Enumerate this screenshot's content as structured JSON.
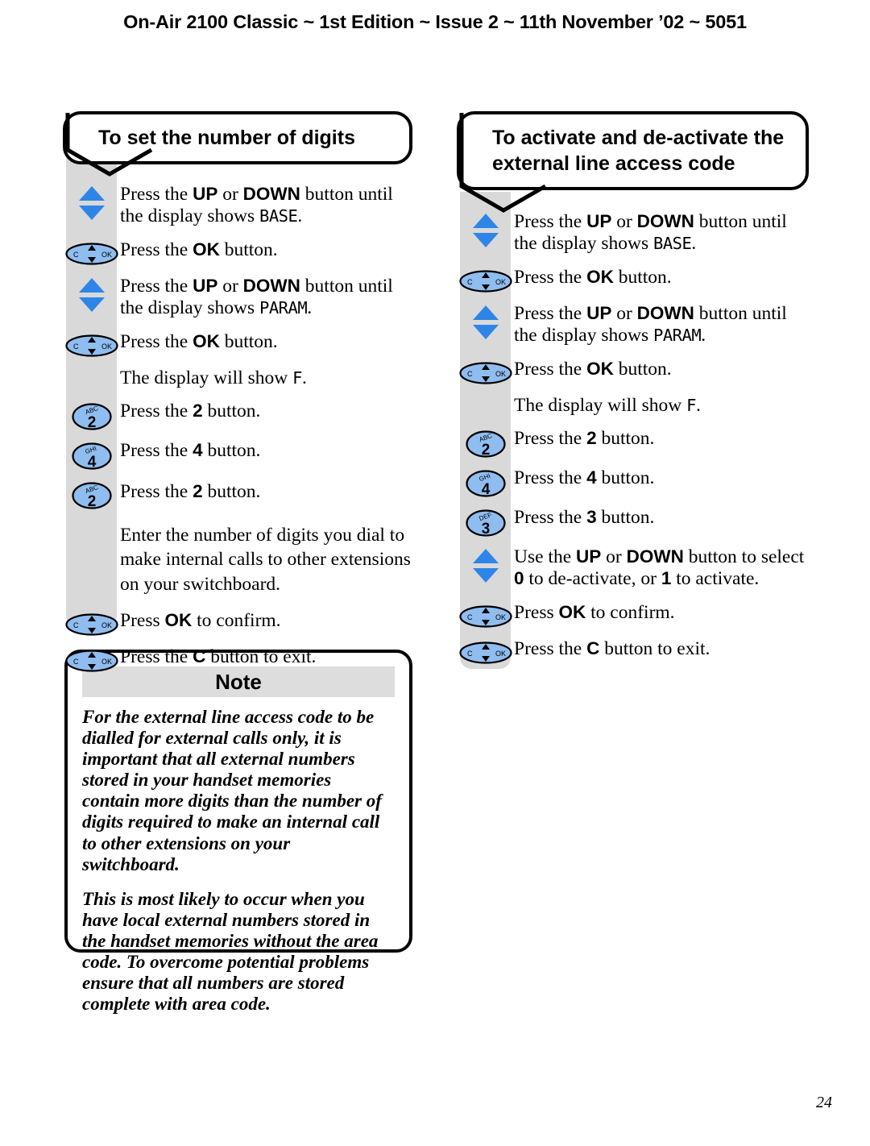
{
  "header": {
    "text": "On-Air 2100 Classic ~ 1st Edition ~ Issue 2 ~ 11th November ’02 ~ 5051"
  },
  "colors": {
    "key_blue": "#8fbdf0",
    "arrow_blue": "#2e85e8",
    "strip_grey": "#d9d9d9",
    "note_band_grey": "#dddddd",
    "outline": "#000000"
  },
  "procedures": [
    {
      "id": "set-number-of-digits",
      "heading": "To set the number of digits",
      "heading_lines": [
        "To set the number of digits"
      ],
      "steps": [
        {
          "icon": "up-down-arrows-icon",
          "lines": [
            "Press the <b>UP</b> or <b>DOWN</b> button until",
            "the display shows <span class=\"lcd\">BASE</span>."
          ]
        },
        {
          "icon": "c-ok-navigation-key-icon",
          "lines": [
            "Press the <b>OK</b> button."
          ]
        },
        {
          "icon": "up-down-arrows-icon",
          "lines": [
            "Press the <b>UP</b> or <b>DOWN</b> button until",
            "the display shows <span class=\"lcd\">PARAM</span>."
          ]
        },
        {
          "icon": "c-ok-navigation-key-icon",
          "lines": [
            "Press the <b>OK</b> button."
          ]
        },
        {
          "icon": "none",
          "lines": [
            "The display will show <span class=\"lcd\">F</span>."
          ]
        },
        {
          "icon": "keypad-key-2-icon",
          "lines": [
            "Press the <b>2</b> button."
          ]
        },
        {
          "icon": "keypad-key-4-icon",
          "lines": [
            "Press the <b>4</b> button."
          ]
        },
        {
          "icon": "keypad-key-2-icon",
          "lines": [
            "Press the <b>2</b> button."
          ]
        },
        {
          "icon": "none",
          "lines": [
            "Enter the number of digits you dial to",
            "make internal calls to other extensions",
            "on your switchboard."
          ]
        },
        {
          "icon": "c-ok-navigation-key-icon",
          "lines": [
            "Press <b>OK</b> to confirm."
          ]
        },
        {
          "icon": "c-ok-navigation-key-icon",
          "lines": [
            "Press the <b>C</b> button to exit."
          ]
        }
      ]
    },
    {
      "id": "activate-external-line-access-code",
      "heading": "To activate and de-activate the external line access code",
      "heading_lines": [
        "To activate and de-activate the",
        "external line access code"
      ],
      "steps": [
        {
          "icon": "up-down-arrows-icon",
          "lines": [
            "Press the <b>UP</b> or <b>DOWN</b> button until",
            "the display shows <span class=\"lcd\">BASE</span>."
          ]
        },
        {
          "icon": "c-ok-navigation-key-icon",
          "lines": [
            "Press the <b>OK</b> button."
          ]
        },
        {
          "icon": "up-down-arrows-icon",
          "lines": [
            "Press the <b>UP</b> or <b>DOWN</b> button until",
            "the display shows <span class=\"lcd\">PARAM</span>."
          ]
        },
        {
          "icon": "c-ok-navigation-key-icon",
          "lines": [
            "Press the <b>OK</b> button."
          ]
        },
        {
          "icon": "none",
          "lines": [
            "The display will show <span class=\"lcd\">F</span>."
          ]
        },
        {
          "icon": "keypad-key-2-icon",
          "lines": [
            "Press the <b>2</b> button."
          ]
        },
        {
          "icon": "keypad-key-4-icon",
          "lines": [
            "Press the <b>4</b> button."
          ]
        },
        {
          "icon": "keypad-key-3-icon",
          "lines": [
            "Press the <b>3</b> button."
          ]
        },
        {
          "icon": "up-down-arrows-icon",
          "lines": [
            "Use the <b>UP</b> or <b>DOWN</b> button to select",
            "<b>0</b> to de-activate, or <b>1</b> to activate."
          ]
        },
        {
          "icon": "c-ok-navigation-key-icon",
          "lines": [
            "Press <b>OK</b> to confirm."
          ]
        },
        {
          "icon": "c-ok-navigation-key-icon",
          "lines": [
            "Press the <b>C</b> button to exit."
          ]
        }
      ]
    }
  ],
  "note": {
    "title": "Note",
    "paragraphs": [
      "For the external line access code to be dialled for external calls only, it is important that all external numbers stored in your handset memories contain more digits than the number of digits required to make an internal call to other extensions on your switchboard.",
      "This is most likely to occur when you have local external numbers stored in the handset memories without the area code. To overcome potential problems ensure that all numbers are stored complete with area code."
    ]
  },
  "keypad_keys": {
    "2": {
      "digit": "2",
      "letters": "ABC"
    },
    "3": {
      "digit": "3",
      "letters": "DEF"
    },
    "4": {
      "digit": "4",
      "letters": "GHI"
    }
  },
  "nav_key": {
    "left_label": "C",
    "right_label": "OK"
  },
  "page_number": "24"
}
